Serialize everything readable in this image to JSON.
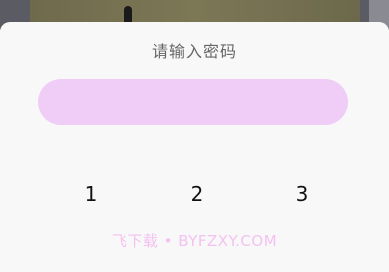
{
  "dialog": {
    "title": "请输入密码",
    "password_value": "",
    "accent_color": "#efcdf7"
  },
  "keypad": {
    "keys": [
      "1",
      "2",
      "3"
    ]
  },
  "watermark": "飞下载 • BYFZXY.COM"
}
